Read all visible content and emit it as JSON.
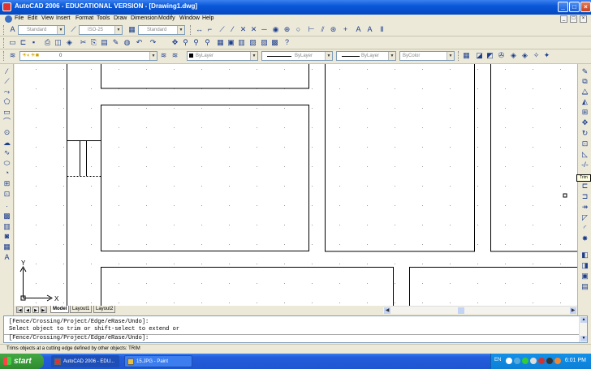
{
  "window": {
    "title": "AutoCAD 2006 - EDUCATIONAL VERSION - [Drawing1.dwg]"
  },
  "menu": [
    "File",
    "Edit",
    "View",
    "Insert",
    "Format",
    "Tools",
    "Draw",
    "Dimension",
    "Modify",
    "Window",
    "Help"
  ],
  "styles_toolbar": {
    "text_style": "Standard",
    "dim_style": "ISO-25",
    "table_style": "Standard"
  },
  "properties_toolbar": {
    "layer": "0",
    "color": "ByLayer",
    "linetype": "ByLayer",
    "lineweight": "ByLayer",
    "plot_style": "ByColor"
  },
  "tooltip": "Trim",
  "layout_tabs": [
    "Model",
    "Layout1",
    "Layout2"
  ],
  "active_tab": "Model",
  "ucs": {
    "x_label": "X",
    "y_label": "Y"
  },
  "command_line": {
    "history_1": "[Fence/Crossing/Project/Edge/eRase/Undo]:",
    "history_2": "Select object to trim or shift-select to extend or",
    "prompt": "[Fence/Crossing/Project/Edge/eRase/Undo]:"
  },
  "status_bar": {
    "text": "Trims objects at a cutting edge defined by other objects:  TRIM"
  },
  "taskbar": {
    "start_label": "start",
    "items": [
      "AutoCAD 2006 - EDU...",
      "15.JPG - Paint"
    ],
    "language": "EN",
    "clock": "6:01 PM"
  },
  "colors": {
    "title_blue": "#0A58D8",
    "xp_gray": "#ECE9D8",
    "start_green": "#3C9E3C",
    "taskbar_blue": "#245EDC"
  }
}
